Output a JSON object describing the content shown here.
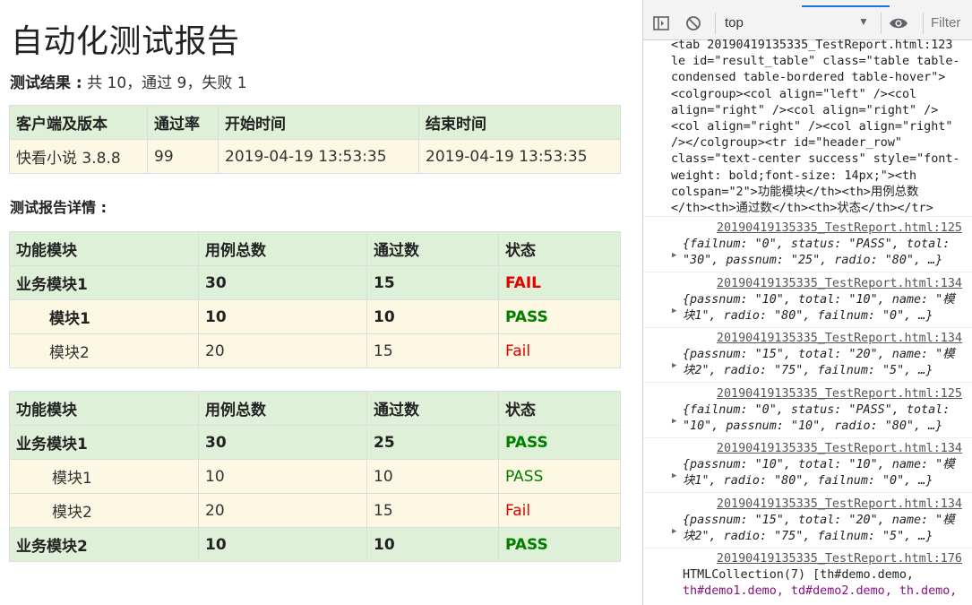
{
  "report": {
    "title": "自动化测试报告",
    "summary_label": "测试结果 :",
    "summary_text": " 共 10，通过 9，失败 1",
    "info_headers": [
      "客户端及版本",
      "通过率",
      "开始时间",
      "结束时间"
    ],
    "info_row": [
      "快看小说 3.8.8",
      "99",
      "2019-04-19 13:53:35",
      "2019-04-19 13:53:35"
    ],
    "details_title": "测试报告详情 :",
    "detail_headers": [
      "功能模块",
      "用例总数",
      "通过数",
      "状态"
    ],
    "table1": [
      [
        "业务模块1",
        "30",
        "15",
        "FAIL"
      ],
      [
        "模块1",
        "10",
        "10",
        "PASS"
      ],
      [
        "模块2",
        "20",
        "15",
        "Fail"
      ]
    ],
    "table2": [
      [
        "业务模块1",
        "30",
        "25",
        "PASS"
      ],
      [
        "模块1",
        "10",
        "10",
        "PASS"
      ],
      [
        "模块2",
        "20",
        "15",
        "Fail"
      ],
      [
        "业务模块2",
        "10",
        "10",
        "PASS"
      ]
    ]
  },
  "devtools": {
    "context": "top",
    "filter_placeholder": "Filter",
    "html_lines": [
      "<tab 20190419135335_TestReport.html:123",
      "le id=\"result_table\" class=\"table table-",
      "condensed table-bordered table-hover\">",
      "<colgroup><col align=\"left\" /><col",
      "align=\"right\" /><col align=\"right\" />",
      "<col align=\"right\" /><col align=\"right\"",
      "/></colgroup><tr id=\"header_row\"",
      "class=\"text-center success\" style=\"font-",
      "weight: bold;font-size: 14px;\"><th",
      "colspan=\"2\">功能模块</th><th>用例总数",
      "</th><th>通过数</th><th>状态</th></tr>"
    ],
    "messages": [
      {
        "src": "20190419135335_TestReport.html:125",
        "l1": "{failnum: \"0\", status: \"PASS\", total:",
        "l2": "\"30\", passnum: \"25\", radio: \"80\", …}"
      },
      {
        "src": "20190419135335_TestReport.html:134",
        "l1": "{passnum: \"10\", total: \"10\", name: \"模",
        "l2": "块1\", radio: \"80\", failnum: \"0\", …}"
      },
      {
        "src": "20190419135335_TestReport.html:134",
        "l1": "{passnum: \"15\", total: \"20\", name: \"模",
        "l2": "块2\", radio: \"75\", failnum: \"5\", …}"
      },
      {
        "src": "20190419135335_TestReport.html:125",
        "l1": "{failnum: \"0\", status: \"PASS\", total:",
        "l2": "\"10\", passnum: \"10\", radio: \"80\", …}"
      },
      {
        "src": "20190419135335_TestReport.html:134",
        "l1": "{passnum: \"10\", total: \"10\", name: \"模",
        "l2": "块1\", radio: \"80\", failnum: \"0\", …}"
      },
      {
        "src": "20190419135335_TestReport.html:134",
        "l1": "{passnum: \"15\", total: \"20\", name: \"模",
        "l2": "块2\", radio: \"75\", failnum: \"5\", …}"
      }
    ],
    "last_src": "20190419135335_TestReport.html:176",
    "last_l1": "HTMLCollection(7) [th#demo.demo,",
    "last_l2": "th#demo1.demo, td#demo2.demo, th.demo,"
  }
}
